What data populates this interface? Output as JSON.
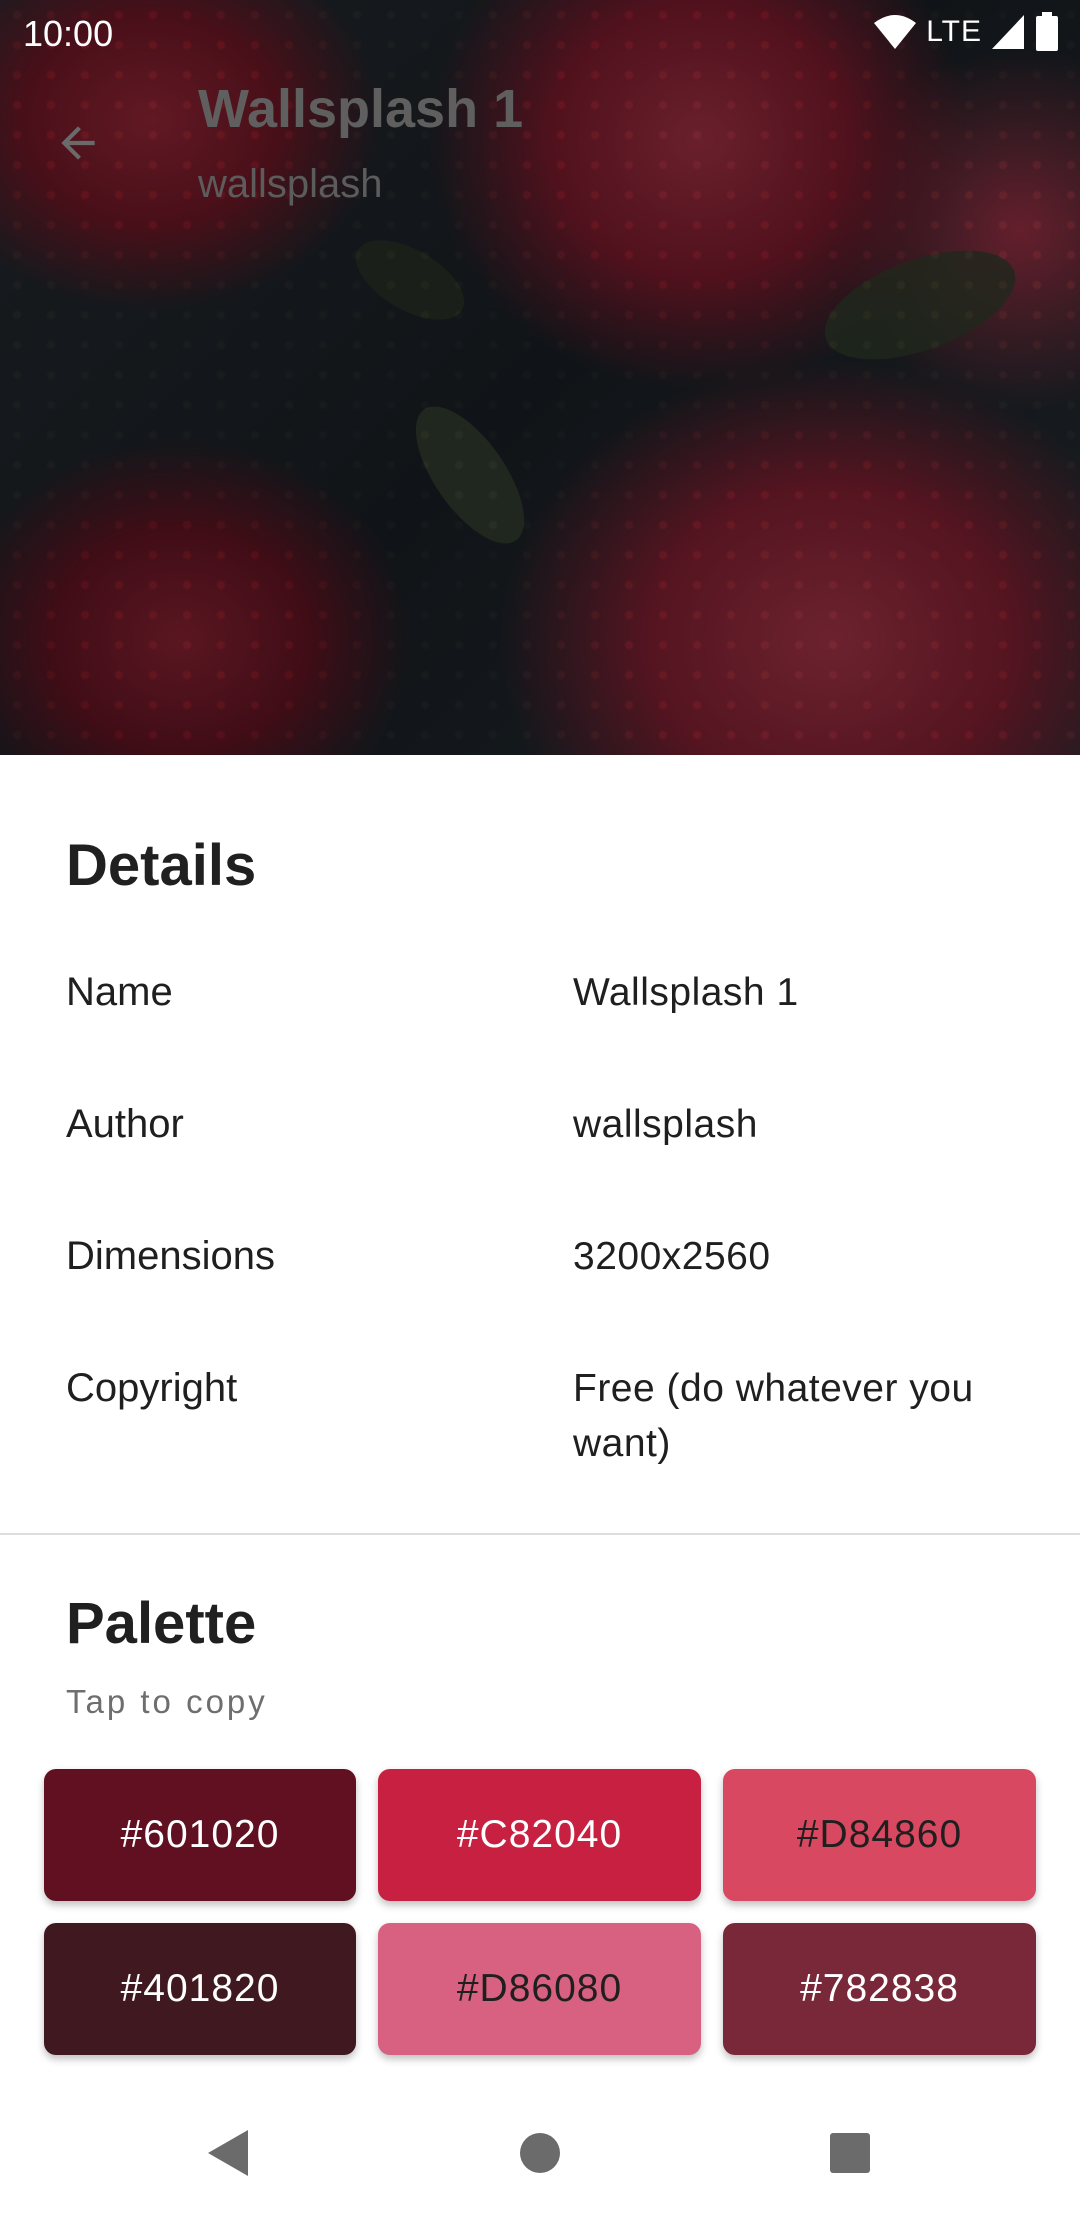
{
  "status_bar": {
    "time": "10:00",
    "network": "LTE",
    "icons": [
      "wifi-icon",
      "cell-signal-icon",
      "battery-icon"
    ]
  },
  "hero": {
    "title": "Wallsplash 1",
    "subtitle": "wallsplash",
    "back_icon": "arrow-back-icon"
  },
  "details": {
    "heading": "Details",
    "rows": [
      {
        "label": "Name",
        "value": "Wallsplash 1"
      },
      {
        "label": "Author",
        "value": "wallsplash"
      },
      {
        "label": "Dimensions",
        "value": "3200x2560"
      },
      {
        "label": "Copyright",
        "value": "Free (do whatever you want)"
      }
    ]
  },
  "palette": {
    "heading": "Palette",
    "hint": "Tap to copy",
    "swatches": [
      {
        "label": "#601020",
        "color": "#601020",
        "text_color": "#ffffff"
      },
      {
        "label": "#C82040",
        "color": "#C82040",
        "text_color": "#ffffff"
      },
      {
        "label": "#D84860",
        "color": "#D84860",
        "text_color": "#1f1f1f"
      },
      {
        "label": "#401820",
        "color": "#401820",
        "text_color": "#ffffff"
      },
      {
        "label": "#D86080",
        "color": "#D86080",
        "text_color": "#1f1f1f"
      },
      {
        "label": "#782838",
        "color": "#782838",
        "text_color": "#ffffff"
      }
    ]
  },
  "nav_bar": {
    "icons": [
      "back-triangle-icon",
      "home-circle-icon",
      "recents-square-icon"
    ]
  }
}
